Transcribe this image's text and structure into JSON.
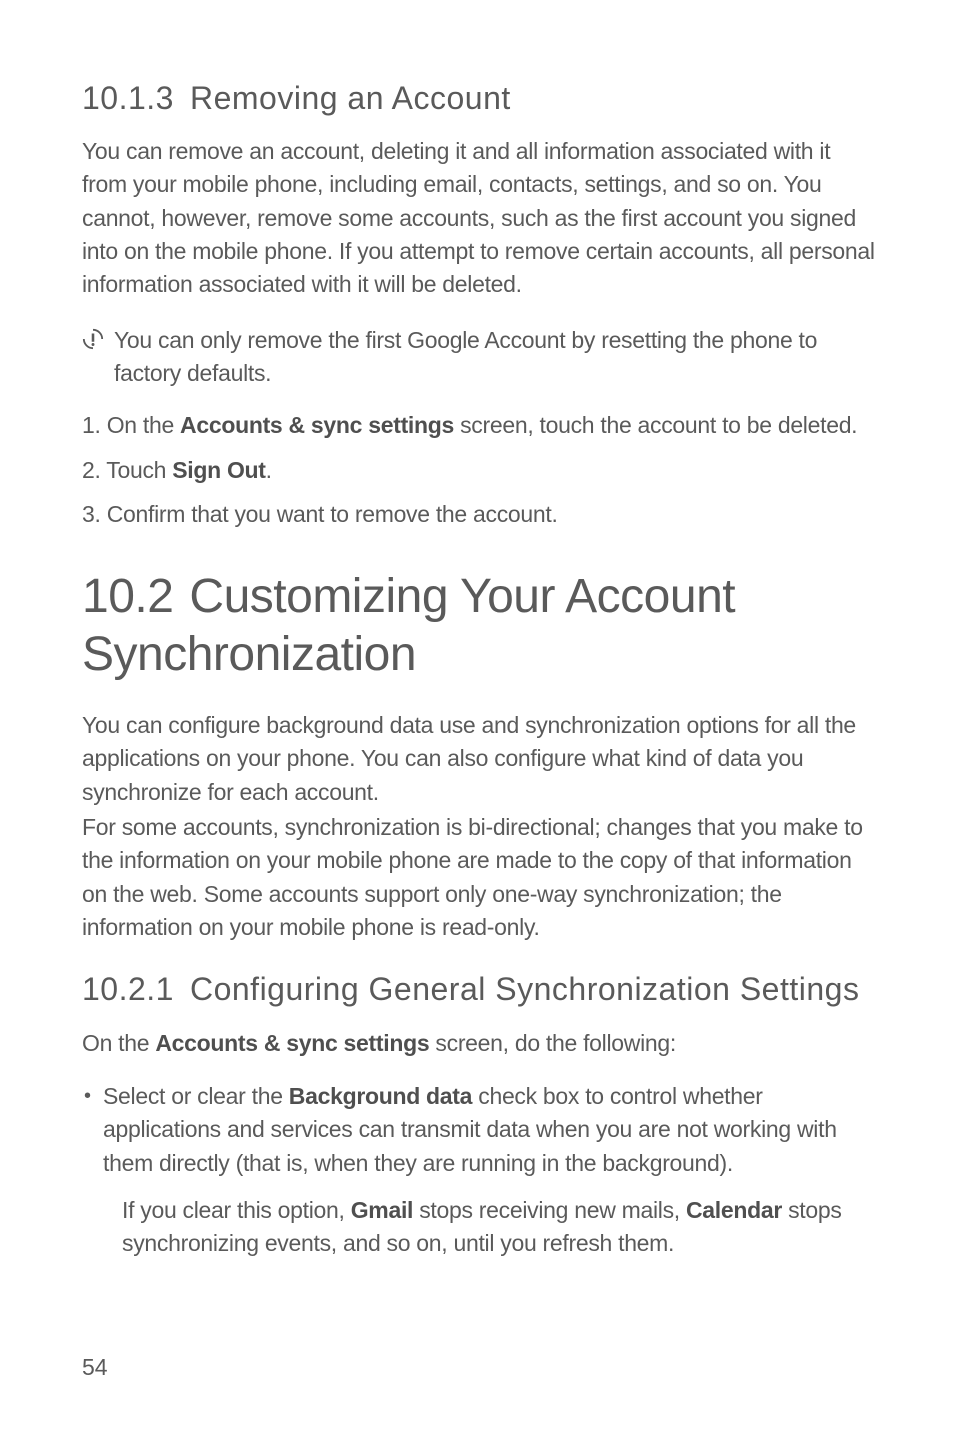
{
  "section_10_1_3": {
    "number": "10.1.3",
    "title": "Removing an Account",
    "paragraph": "You can remove an account, deleting it and all information associated with it from your mobile phone, including email, contacts, settings, and so on. You cannot, however, remove some accounts, such as the first account you signed into on the mobile phone. If you attempt to remove certain accounts, all personal information associated with it will be deleted.",
    "note": "You can only remove the first Google Account by resetting the phone to factory defaults.",
    "steps": {
      "s1": {
        "num": "1.",
        "pre": "On the ",
        "bold": "Accounts & sync settings",
        "post": " screen, touch the account to be deleted."
      },
      "s2": {
        "num": "2.",
        "pre": "Touch ",
        "bold": "Sign Out",
        "post": "."
      },
      "s3": {
        "num": "3.",
        "text": "Confirm that you want to remove the account."
      }
    }
  },
  "section_10_2": {
    "number": "10.2",
    "title": "Customizing Your Account Synchronization",
    "p1": "You can configure background data use and synchronization options for all the applications on your phone. You can also configure what kind of data you synchronize for each account.",
    "p2": "For some accounts, synchronization is bi-directional; changes that you make to the information on your mobile phone are made to the copy of that information on the web. Some accounts support only one-way synchronization; the information on your mobile phone is read-only."
  },
  "section_10_2_1": {
    "number": "10.2.1",
    "title": "Configuring General Synchronization Settings",
    "intro": {
      "pre": "On the ",
      "bold": "Accounts & sync settings",
      "post": " screen, do the following:"
    },
    "bullet": {
      "pre": "Select or clear the ",
      "bold": "Background data",
      "post": " check box to control whether applications and services can transmit data when you are not working with them directly (that is, when they are running in the background)."
    },
    "sub": {
      "pre": "If you clear this option, ",
      "bold1": "Gmail",
      "mid": " stops receiving new mails, ",
      "bold2": "Calendar",
      "post": " stops synchronizing events, and so on, until you refresh them."
    }
  },
  "page_number": "54"
}
